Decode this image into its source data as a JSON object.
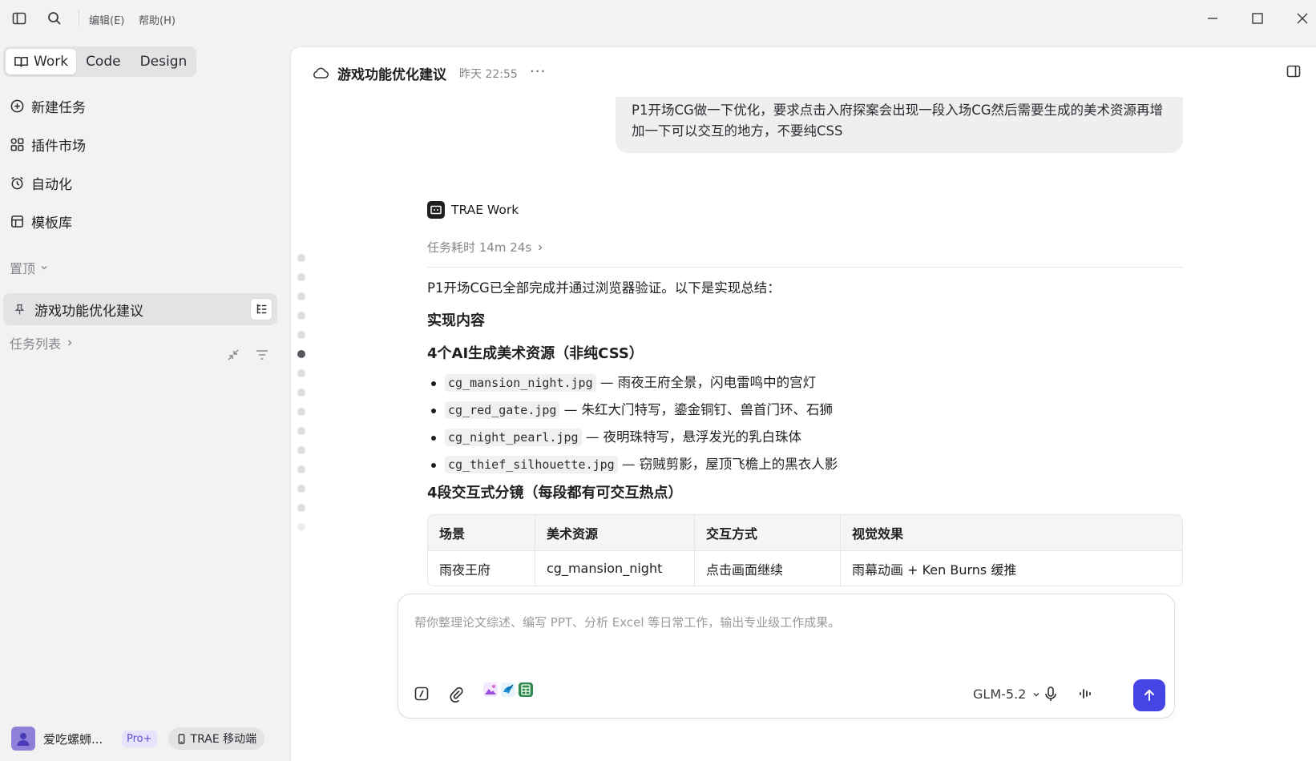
{
  "titlebar": {
    "menus": [
      "编辑(E)",
      "帮助(H)"
    ]
  },
  "sidebar": {
    "modes": [
      "Work",
      "Code",
      "Design"
    ],
    "nav": [
      "新建任务",
      "插件市场",
      "自动化",
      "模板库"
    ],
    "pinned_label": "置顶",
    "pinned_task": "游戏功能优化建议",
    "task_list_label": "任务列表",
    "user": {
      "name": "爱吃螺蛳...",
      "badge": "Pro+",
      "mobile": "TRAE 移动端"
    }
  },
  "header": {
    "title": "游戏功能优化建议",
    "time": "昨天 22:55",
    "more": "···"
  },
  "chat": {
    "user_message": "P1开场CG做一下优化，要求点击入府探案会出现一段入场CG然后需要生成的美术资源再增加一下可以交互的地方，不要纯CSS",
    "assistant_name": "TRAE Work",
    "duration": "任务耗时 14m 24s",
    "intro": "P1开场CG已全部完成并通过浏览器验证。以下是实现总结：",
    "h_impl": "实现内容",
    "h_assets": "4个AI生成美术资源（非纯CSS）",
    "assets": [
      {
        "file": "cg_mansion_night.jpg",
        "desc": "— 雨夜王府全景，闪电雷鸣中的宫灯"
      },
      {
        "file": "cg_red_gate.jpg",
        "desc": "— 朱红大门特写，鎏金铜钉、兽首门环、石狮"
      },
      {
        "file": "cg_night_pearl.jpg",
        "desc": "— 夜明珠特写，悬浮发光的乳白珠体"
      },
      {
        "file": "cg_thief_silhouette.jpg",
        "desc": "— 窃贼剪影，屋顶飞檐上的黑衣人影"
      }
    ],
    "h_scenes": "4段交互式分镜（每段都有可交互热点）",
    "table": {
      "headers": [
        "场景",
        "美术资源",
        "交互方式",
        "视觉效果"
      ],
      "rows": [
        [
          "雨夜王府",
          "cg_mansion_night",
          "点击画面继续",
          "雨幕动画 + Ken Burns 缓推"
        ]
      ]
    }
  },
  "composer": {
    "placeholder": "帮你整理论文综述、编写 PPT、分析 Excel 等日常工作，输出专业级工作成果。",
    "model": "GLM-5.2"
  }
}
